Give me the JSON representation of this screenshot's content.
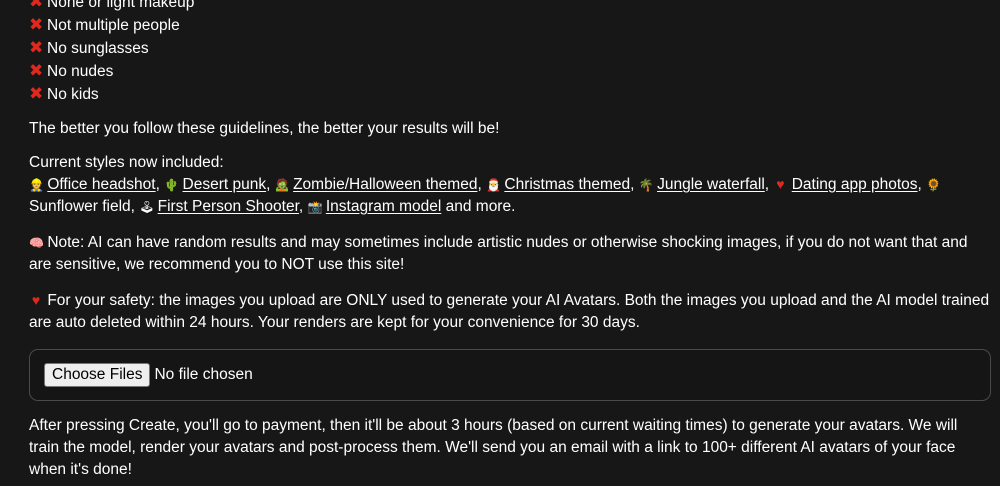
{
  "rules": [
    "None or light makeup",
    "Not multiple people",
    "No sunglasses",
    "No nudes",
    "No kids"
  ],
  "rule_icon": "cross-mark-icon",
  "guideline_text": "The better you follow these guidelines, the better your results will be!",
  "styles": {
    "heading": "Current styles now included:",
    "items": [
      {
        "icon": "office-worker-icon",
        "label": "Office headshot",
        "link": true
      },
      {
        "icon": "cactus-icon",
        "label": "Desert punk",
        "link": true
      },
      {
        "icon": "zombie-icon",
        "label": "Zombie/Halloween themed",
        "link": true
      },
      {
        "icon": "santa-icon",
        "label": "Christmas themed",
        "link": true
      },
      {
        "icon": "palm-tree-icon",
        "label": "Jungle waterfall",
        "link": true
      },
      {
        "icon": "heart-ribbon-icon",
        "label": "Dating app photos",
        "link": true
      },
      {
        "icon": "sunflower-icon",
        "label": "Sunflower field",
        "link": false
      },
      {
        "icon": "joystick-icon",
        "label": "First Person Shooter",
        "link": true
      },
      {
        "icon": "camera-flash-icon",
        "label": "Instagram model",
        "link": true
      }
    ],
    "suffix": "and more."
  },
  "note": {
    "icon": "brain-icon",
    "text": "Note: AI can have random results and may sometimes include artistic nudes or otherwise shocking images, if you do not want that and are sensitive, we recommend you to NOT use this site!"
  },
  "safety": {
    "icon": "red-heart-icon",
    "text": "For your safety: the images you upload are ONLY used to generate your AI Avatars. Both the images you upload and the AI model trained are auto deleted within 24 hours. Your renders are kept for your convenience for 30 days."
  },
  "upload": {
    "button_label": "Choose Files",
    "status": "No file chosen"
  },
  "after_text": "After pressing Create, you'll go to payment, then it'll be about 3 hours (based on current waiting times) to generate your avatars. We will train the model, render your avatars and post-process them. We'll send you an email with a link to 100+ different AI avatars of your face when it's done!",
  "colors": {
    "background": "#171717",
    "text": "#ffffff",
    "cross": "#e0281f",
    "upload_border": "#4a4a4a"
  }
}
